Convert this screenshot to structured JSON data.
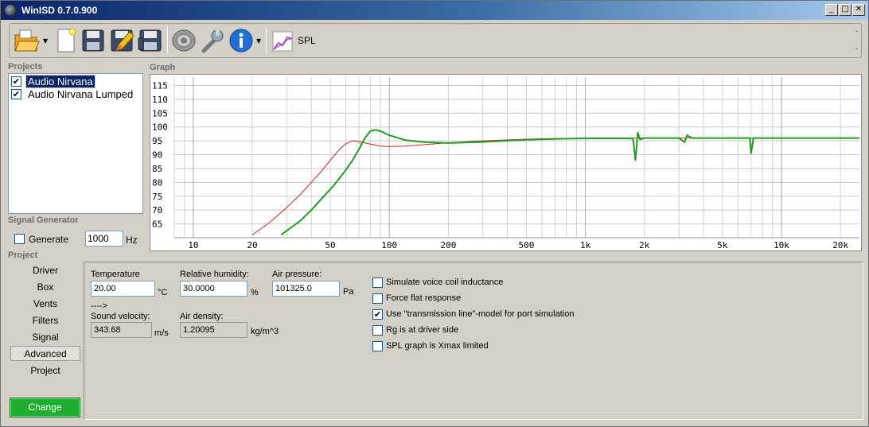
{
  "window": {
    "title": "WinISD 0.7.0.900",
    "minimize_glyph": "_",
    "maximize_glyph": "□",
    "close_glyph": "✕"
  },
  "toolbar": {
    "icons": [
      "open-folder-icon",
      "new-file-icon",
      "save-icon",
      "edit-icon",
      "save-as-icon",
      "speaker-driver-icon",
      "wrench-icon",
      "info-icon"
    ],
    "spl_label": "SPL",
    "dropdown_glyph": "▼",
    "right_marks": [
      "-",
      "-"
    ]
  },
  "projects": {
    "heading": "Projects",
    "items": [
      {
        "label": "Audio Nirvana",
        "checked": true,
        "selected": true
      },
      {
        "label": "Audio Nirvana Lumped",
        "checked": true,
        "selected": false
      }
    ],
    "check_glyph": "✔"
  },
  "signal_generator": {
    "heading": "Signal Generator",
    "generate_label": "Generate",
    "generate_checked": false,
    "frequency": "1000",
    "unit": "Hz"
  },
  "project_nav": {
    "heading": "Project",
    "items": [
      "Driver",
      "Box",
      "Vents",
      "Filters",
      "Signal",
      "Advanced",
      "Project"
    ],
    "active": "Advanced",
    "change_label": "Change"
  },
  "graph": {
    "heading": "Graph"
  },
  "chart_data": {
    "type": "line",
    "x_scale": "log",
    "xlim": [
      8,
      25000
    ],
    "ylim": [
      60,
      118
    ],
    "x_tick_labels": [
      "10",
      "20",
      "50",
      "100",
      "200",
      "500",
      "1k",
      "2k",
      "5k",
      "10k",
      "20k"
    ],
    "x_tick_values": [
      10,
      20,
      50,
      100,
      200,
      500,
      1000,
      2000,
      5000,
      10000,
      20000
    ],
    "y_tick_labels": [
      "65",
      "70",
      "75",
      "80",
      "85",
      "90",
      "95",
      "100",
      "105",
      "110",
      "115"
    ],
    "y_tick_values": [
      65,
      70,
      75,
      80,
      85,
      90,
      95,
      100,
      105,
      110,
      115
    ],
    "grid": true,
    "series": [
      {
        "color": "#d42020",
        "x": [
          20,
          25,
          30,
          35,
          40,
          45,
          50,
          55,
          60,
          65,
          70,
          80,
          90,
          100,
          120,
          150,
          200,
          300,
          500,
          700,
          1000,
          2000,
          5000,
          10000,
          20000,
          25000
        ],
        "y": [
          61,
          66,
          71,
          75.5,
          80,
          84,
          88,
          91.5,
          94,
          95,
          94.7,
          93.8,
          93.1,
          92.9,
          93.1,
          93.6,
          94.3,
          95,
          95.6,
          95.8,
          95.9,
          96,
          96,
          96,
          96,
          96
        ]
      },
      {
        "color": "#1e9e1e",
        "x": [
          28,
          35,
          40,
          45,
          50,
          55,
          60,
          65,
          70,
          75,
          80,
          85,
          90,
          100,
          120,
          150,
          200,
          300,
          500,
          700,
          1000,
          1500,
          1750,
          1800,
          1850,
          1900,
          2000,
          3000,
          3200,
          3300,
          3500,
          5000,
          6900,
          7000,
          7200,
          7500,
          10000,
          20000,
          25000
        ],
        "y": [
          61,
          66,
          70,
          74,
          77.5,
          81,
          84.5,
          88,
          92,
          96,
          98.5,
          99,
          98.5,
          97,
          95.3,
          94.5,
          94.2,
          94.6,
          95.4,
          95.7,
          95.9,
          95.9,
          95.8,
          88,
          98,
          95.5,
          96,
          96,
          94.5,
          97,
          96,
          96,
          96,
          90.5,
          96,
          96,
          96,
          96,
          96
        ]
      }
    ]
  },
  "advanced": {
    "temperature": {
      "label": "Temperature",
      "value": "20.00",
      "unit": "°C"
    },
    "humidity": {
      "label": "Relative humidity:",
      "value": "30.0000",
      "unit": "%"
    },
    "pressure": {
      "label": "Air pressure:",
      "value": "101325.0",
      "unit": "Pa"
    },
    "arrow_text": "---->",
    "sound_velocity": {
      "label": "Sound velocity:",
      "value": "343.68",
      "unit": "m/s"
    },
    "air_density": {
      "label": "Air density:",
      "value": "1.20095",
      "unit": "kg/m^3"
    },
    "options": [
      {
        "label": "Simulate voice coil inductance",
        "checked": false
      },
      {
        "label": "Force flat response",
        "checked": false
      },
      {
        "label": "Use \"transmission line\"-model for port simulation",
        "checked": true
      },
      {
        "label": "Rg is at driver side",
        "checked": false
      },
      {
        "label": "SPL graph is Xmax limited",
        "checked": false
      }
    ],
    "check_glyph": "✔"
  }
}
